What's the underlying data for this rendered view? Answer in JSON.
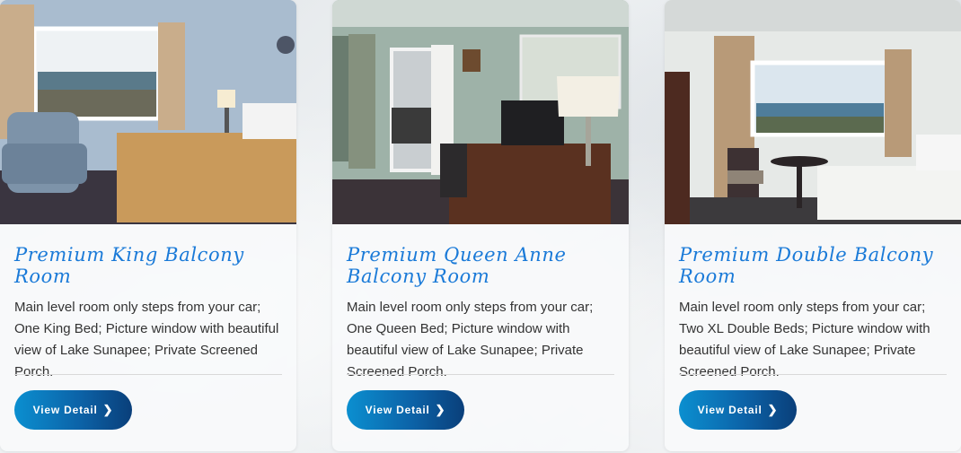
{
  "rooms": [
    {
      "title": "Premium King Balcony Room",
      "description": "Main level room only steps from your car; One King Bed; Picture window with beautiful view of Lake Sunapee; Private Screened Porch.",
      "button_label": "View Detail",
      "button_icon": "chevron-right-icon"
    },
    {
      "title": "Premium Queen Anne Balcony Room",
      "description": "Main level room only steps from your car; One Queen Bed; Picture window with beautiful view of Lake Sunapee; Private Screened Porch.",
      "button_label": "View Detail",
      "button_icon": "chevron-right-icon"
    },
    {
      "title": "Premium Double Balcony Room",
      "description": "Main level room only steps from your car; Two XL Double Beds; Picture window with beautiful view of Lake Sunapee; Private Screened Porch.",
      "button_label": "View Detail",
      "button_icon": "chevron-right-icon"
    }
  ],
  "colors": {
    "title": "#1a7ad8",
    "button_start": "#0b8fd0",
    "button_end": "#0a3f7a"
  }
}
